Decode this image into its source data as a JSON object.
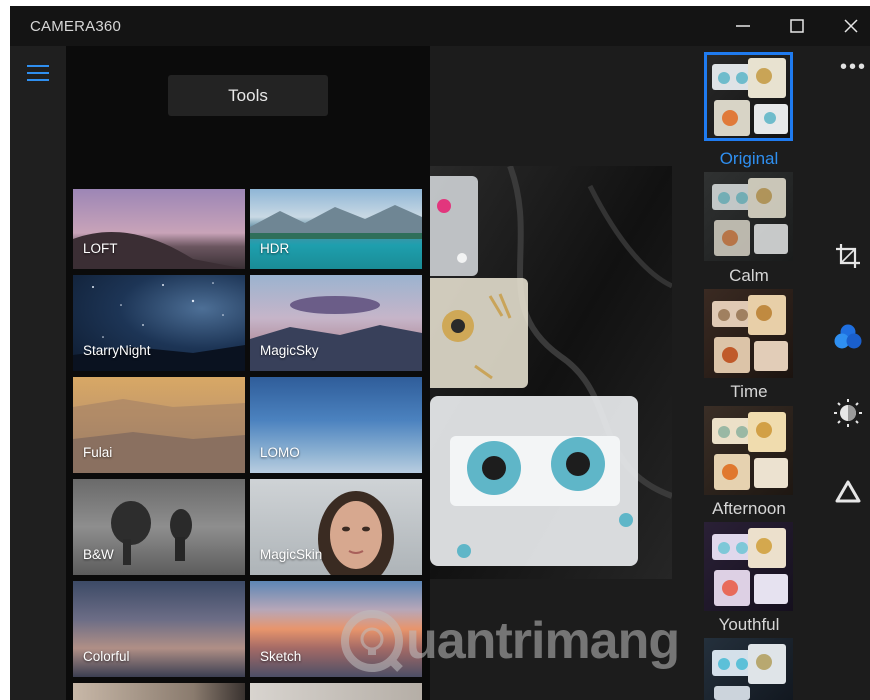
{
  "app": {
    "title": "CAMERA360"
  },
  "window_controls": {
    "minimize": "—",
    "maximize": "☐",
    "close": "✕"
  },
  "sidebar": {
    "menu_icon": "hamburger-icon"
  },
  "panel": {
    "tools_label": "Tools",
    "tiles": [
      {
        "label": "LOFT"
      },
      {
        "label": "HDR"
      },
      {
        "label": "StarryNight"
      },
      {
        "label": "MagicSky"
      },
      {
        "label": "Fulai"
      },
      {
        "label": "LOMO"
      },
      {
        "label": "B&W"
      },
      {
        "label": "MagicSkin"
      },
      {
        "label": "Colorful"
      },
      {
        "label": "Sketch"
      }
    ]
  },
  "filters": {
    "items": [
      {
        "label": "Original",
        "selected": true
      },
      {
        "label": "Calm"
      },
      {
        "label": "Time"
      },
      {
        "label": "Afternoon"
      },
      {
        "label": "Youthful"
      }
    ]
  },
  "right_toolbar": {
    "icons": [
      "more-icon",
      "crop-icon",
      "color-filter-icon",
      "brightness-icon",
      "shape-icon"
    ]
  },
  "watermark": {
    "text": "uantrimang"
  },
  "colors": {
    "accent": "#1f7bf0",
    "background": "#1c1c1c",
    "panel": "#0b0b0b"
  }
}
